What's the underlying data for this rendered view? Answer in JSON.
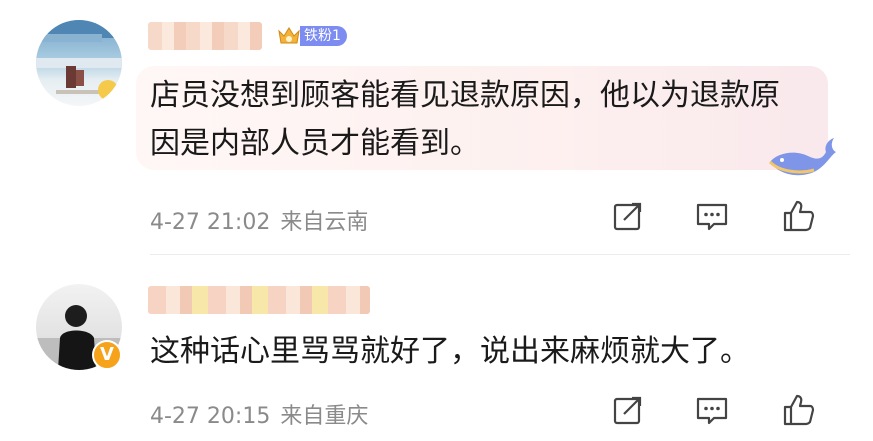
{
  "comments": [
    {
      "fan_badge": "铁粉1",
      "text": "店员没想到顾客能看见退款原因，他以为退款原因是内部人员才能看到。",
      "time": "4-27 21:02",
      "location": "来自云南"
    },
    {
      "text": "这种话心里骂骂就好了，说出来麻烦就大了。",
      "time": "4-27 20:15",
      "location": "来自重庆",
      "verified_badge": "V"
    }
  ],
  "colors": {
    "fan_badge_bg": "#7c8cf0",
    "verified_badge_bg": "#f6a21a",
    "meta_text": "#8a8a8a",
    "icon_stroke": "#444444"
  },
  "icons": [
    "share-icon",
    "comment-icon",
    "like-icon",
    "whale-icon",
    "crown-icon"
  ]
}
